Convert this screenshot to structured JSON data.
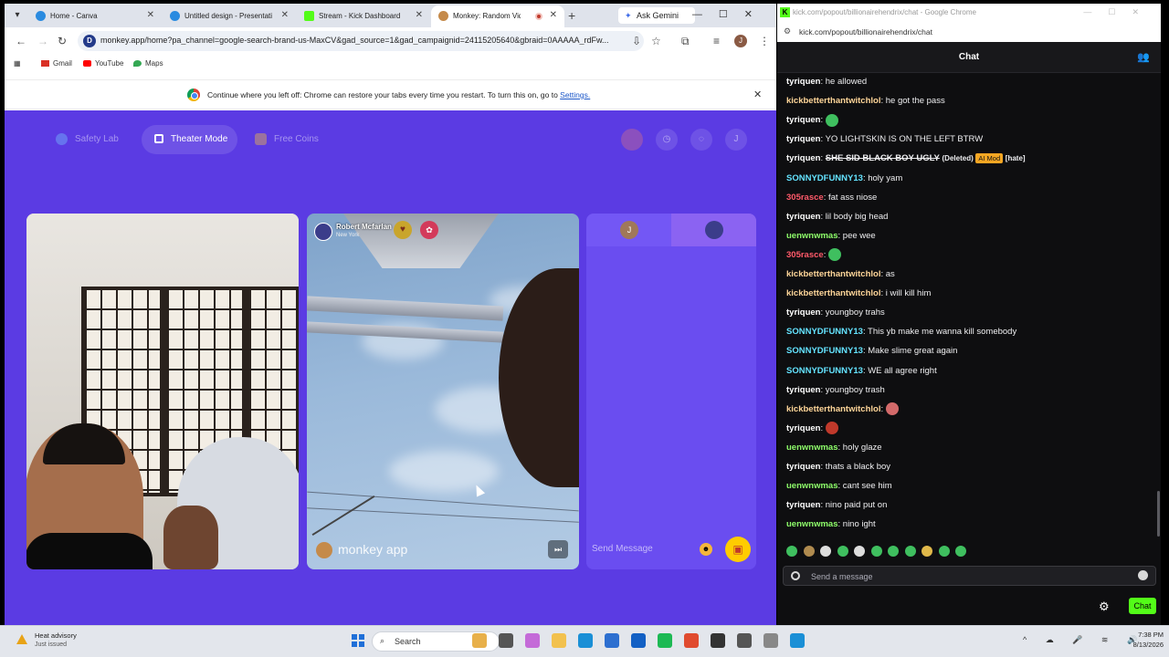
{
  "browser_left": {
    "tabs": [
      {
        "label": "Home - Canva",
        "favicon_color": "#2a8be0"
      },
      {
        "label": "Untitled design - Presentati",
        "favicon_color": "#2a8be0"
      },
      {
        "label": "Stream - Kick Dashboard",
        "favicon_color": "#53fc18"
      },
      {
        "label": "Monkey: Random Video",
        "favicon_color": "#c58a4a"
      }
    ],
    "new_tab_icon": "+",
    "gemini_label": "Ask Gemini",
    "url": "monkey.app/home?pa_channel=google-search-brand-us-MaxCV&gad_source=1&gad_campaignid=24115205640&gbraid=0AAAAA_rdFw...",
    "profile_initial": "J",
    "bookmarks": [
      {
        "label": "Gmail",
        "icon": "gmail-icon",
        "color": "#d93025"
      },
      {
        "label": "YouTube",
        "icon": "youtube-icon",
        "color": "#ff0000"
      },
      {
        "label": "Maps",
        "icon": "maps-icon",
        "color": "#34a853"
      }
    ],
    "restore_bar": {
      "message": "Continue where you left off: Chrome can restore your tabs every time you restart. To turn this on, go to",
      "link": "Settings."
    }
  },
  "monkey": {
    "accent": "#5b3be3",
    "top_buttons": [
      "Safety Lab",
      "Theater Mode",
      "Free Coins"
    ],
    "top_right_icons": [
      "coin-icon",
      "history-icon",
      "chat-icon",
      "profile-icon"
    ],
    "profile_initial": "J",
    "remote_user": {
      "name": "Robert Mcfarlan",
      "location": "New York"
    },
    "watermark": "monkey app",
    "right_panel": {
      "avatar_initial": "J",
      "message_placeholder": "Send Message"
    }
  },
  "kick_window": {
    "window_title": "kick.com/popout/billionairehendrix/chat - Google Chrome",
    "url": "kick.com/popout/billionairehendrix/chat",
    "header": "Chat",
    "messages": [
      {
        "user": "tyriquen",
        "color": "#ffffff",
        "text": "he allowed"
      },
      {
        "user": "kickbetterthantwitchlol",
        "color": "#ffd699",
        "text": "he got the pass"
      },
      {
        "user": "tyriquen",
        "color": "#ffffff",
        "text": "",
        "emote": "#3fbf5f"
      },
      {
        "user": "tyriquen",
        "color": "#ffffff",
        "text": "YO LIGHTSKIN IS ON THE LEFT BTRW"
      },
      {
        "user": "tyriquen",
        "color": "#ffffff",
        "text": "",
        "struck": "SHE SID BLACK BOY UGLY",
        "deleted": "(Deleted)",
        "tag": "AI Mod",
        "extra": "[hate]"
      },
      {
        "user": "SONNYDFUNNY13",
        "color": "#64e3ff",
        "text": "holy yam"
      },
      {
        "user": "305rasce",
        "color": "#ff5a6a",
        "text": "fat ass niose"
      },
      {
        "user": "tyriquen",
        "color": "#ffffff",
        "text": "lil body big head"
      },
      {
        "user": "uenwnwmas",
        "color": "#8fff6b",
        "text": "pee wee"
      },
      {
        "user": "305rasce",
        "color": "#ff5a6a",
        "text": "",
        "emote": "#3fbf5f"
      },
      {
        "user": "kickbetterthantwitchlol",
        "color": "#ffd699",
        "text": "as"
      },
      {
        "user": "kickbetterthantwitchlol",
        "color": "#ffd699",
        "text": "i will kill him"
      },
      {
        "user": "tyriquen",
        "color": "#ffffff",
        "text": "youngboy trahs"
      },
      {
        "user": "SONNYDFUNNY13",
        "color": "#64e3ff",
        "text": "This yb make me wanna kill somebody"
      },
      {
        "user": "SONNYDFUNNY13",
        "color": "#64e3ff",
        "text": "Make slime great again"
      },
      {
        "user": "SONNYDFUNNY13",
        "color": "#64e3ff",
        "text": "WE all agree right"
      },
      {
        "user": "tyriquen",
        "color": "#ffffff",
        "text": "youngboy trash"
      },
      {
        "user": "kickbetterthantwitchlol",
        "color": "#ffd699",
        "text": "",
        "emote": "#d36a6a"
      },
      {
        "user": "tyriquen",
        "color": "#ffffff",
        "text": "",
        "emote": "#c0392b"
      },
      {
        "user": "uenwnwmas",
        "color": "#8fff6b",
        "text": "holy glaze"
      },
      {
        "user": "tyriquen",
        "color": "#ffffff",
        "text": "thats a black boy"
      },
      {
        "user": "uenwnwmas",
        "color": "#8fff6b",
        "text": "cant see him"
      },
      {
        "user": "tyriquen",
        "color": "#ffffff",
        "text": "nino paid put on"
      },
      {
        "user": "uenwnwmas",
        "color": "#8fff6b",
        "text": "nino ight"
      }
    ],
    "emote_colors": [
      "#3fbf5f",
      "#b08b4f",
      "#ddd",
      "#3fbf5f",
      "#ddd",
      "#3fbf5f",
      "#3fbf5f",
      "#3fbf5f",
      "#e0b84a",
      "#3fbf5f",
      "#3fbf5f"
    ],
    "input_placeholder": "Send a message",
    "send_label": "Chat",
    "brand_color": "#53fc18"
  },
  "taskbar": {
    "weather_title": "Heat advisory",
    "weather_sub": "Just issued",
    "search_label": "Search",
    "apps": [
      "#e8b04a",
      "#555",
      "#c46ad8",
      "#f2c14e",
      "#1a8fd6",
      "#2d6fd0",
      "#1360c4",
      "#1db954",
      "#e04b2f",
      "#333",
      "#555",
      "#888",
      "#1a8fd6"
    ],
    "time": "7:38 PM",
    "date": "8/13/2026"
  }
}
